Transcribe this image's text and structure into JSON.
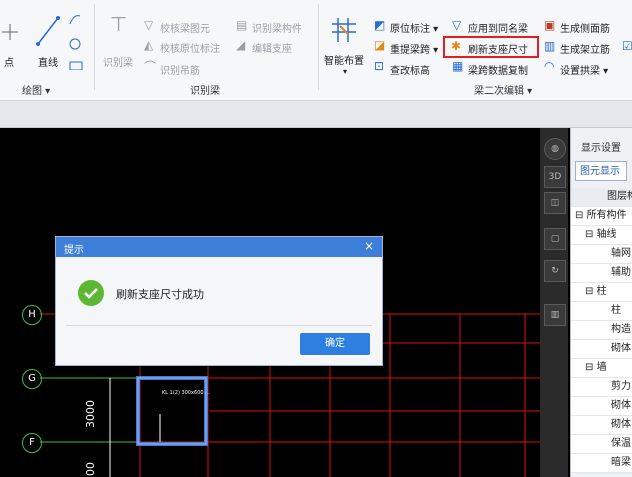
{
  "ribbon": {
    "draw_group": {
      "label": "绘图 ▾",
      "point": "点",
      "line": "直线"
    },
    "recognize_group": {
      "label": "识别梁",
      "recognize_beam": "识别梁",
      "check_beam_drawing": "校核梁图元",
      "check_support_mark": "校核原位标注",
      "recognize_hanger": "识别吊筋",
      "recognize_beam_member": "识别梁构件",
      "edit_support": "编辑支座"
    },
    "secondary_group": {
      "label": "梁二次编辑 ▾",
      "smart_layout": "智能布置",
      "origin_mark": "原位标注 ▾",
      "apply_same_name": "应用到同名梁",
      "generate_side_rebar": "生成侧面筋",
      "re_extract_span": "重提梁跨 ▾",
      "refresh_support_size": "刷新支座尺寸",
      "generate_stirrup": "生成架立筋",
      "check_elevation": "查改标高",
      "copy_span_data": "梁跨数据复制",
      "set_arch_beam": "设置拱梁 ▾"
    }
  },
  "panel": {
    "title": "显示设置",
    "tab": "图元显示",
    "tree": [
      "图层构",
      "所有构件",
      "轴线",
      "轴网",
      "辅助",
      "柱",
      "柱",
      "构造",
      "砌体",
      "墙",
      "剪力",
      "砌体",
      "砌体",
      "保温",
      "暗梁"
    ]
  },
  "dialog": {
    "title": "提示",
    "message": "刷新支座尺寸成功",
    "ok_label": "确定",
    "close_glyph": "×"
  },
  "canvas": {
    "axis_labels": [
      "H",
      "G",
      "F"
    ],
    "dimensions": [
      "3000",
      "00"
    ],
    "beam_text": "KL 1(2) 300x600 ..."
  }
}
